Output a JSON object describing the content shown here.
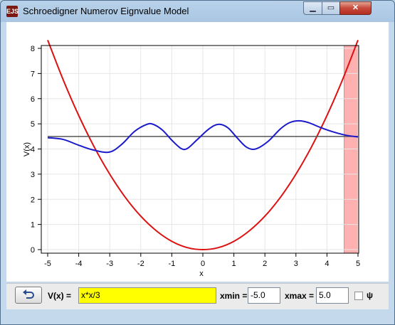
{
  "window": {
    "title": "Schroedigner Numerov Eignvalue Model",
    "icon_text": "EJS",
    "controls": {
      "minimize": "minimize-icon",
      "maximize": "maximize-icon",
      "close": "close-icon"
    }
  },
  "colors": {
    "potential": "#dd1111",
    "wavefunction": "#1a1acc",
    "energy_line": "#555555",
    "boundary_band": "#ffb0b0",
    "input_highlight": "#ffff00"
  },
  "chart_data": {
    "type": "line",
    "title": "",
    "xlabel": "x",
    "ylabel": "V(x)",
    "xlim": [
      -5,
      5
    ],
    "ylim": [
      -0.1,
      8.4
    ],
    "x_ticks": [
      "-5",
      "-4",
      "-3",
      "-2",
      "-1",
      "0",
      "1",
      "2",
      "3",
      "4",
      "5"
    ],
    "y_ticks": [
      "0",
      "1",
      "2",
      "3",
      "4",
      "5",
      "6",
      "7",
      "8"
    ],
    "grid": true,
    "series": [
      {
        "role": "potential",
        "color": "#dd1111",
        "formula": "x*x/3",
        "points": [
          [
            -5,
            8.33
          ],
          [
            -4.5,
            6.75
          ],
          [
            -4,
            5.33
          ],
          [
            -3.5,
            4.08
          ],
          [
            -3,
            3.0
          ],
          [
            -2.5,
            2.08
          ],
          [
            -2,
            1.33
          ],
          [
            -1.5,
            0.75
          ],
          [
            -1,
            0.33
          ],
          [
            -0.5,
            0.08
          ],
          [
            0,
            0
          ],
          [
            0.5,
            0.08
          ],
          [
            1,
            0.33
          ],
          [
            1.5,
            0.75
          ],
          [
            2,
            1.33
          ],
          [
            2.5,
            2.08
          ],
          [
            3,
            3.0
          ],
          [
            3.5,
            4.08
          ],
          [
            4,
            5.33
          ],
          [
            4.5,
            6.75
          ],
          [
            5,
            8.33
          ]
        ]
      },
      {
        "role": "energy",
        "color": "#555555",
        "points": [
          [
            -5,
            4.5
          ],
          [
            5,
            4.5
          ]
        ]
      },
      {
        "role": "wavefunction",
        "color": "#1a1acc",
        "points": [
          [
            -5,
            4.45
          ],
          [
            -4.5,
            4.38
          ],
          [
            -4,
            4.15
          ],
          [
            -3.5,
            3.95
          ],
          [
            -3,
            3.88
          ],
          [
            -2.6,
            4.2
          ],
          [
            -2.2,
            4.7
          ],
          [
            -1.8,
            4.98
          ],
          [
            -1.6,
            4.98
          ],
          [
            -1.3,
            4.75
          ],
          [
            -1,
            4.35
          ],
          [
            -0.7,
            4.02
          ],
          [
            -0.5,
            4.02
          ],
          [
            -0.2,
            4.35
          ],
          [
            0.2,
            4.8
          ],
          [
            0.5,
            4.98
          ],
          [
            0.8,
            4.85
          ],
          [
            1.1,
            4.45
          ],
          [
            1.4,
            4.08
          ],
          [
            1.7,
            4.0
          ],
          [
            2.1,
            4.3
          ],
          [
            2.5,
            4.8
          ],
          [
            2.8,
            5.05
          ],
          [
            3.1,
            5.12
          ],
          [
            3.4,
            5.05
          ],
          [
            3.8,
            4.85
          ],
          [
            4.2,
            4.68
          ],
          [
            4.6,
            4.55
          ],
          [
            5,
            4.48
          ]
        ]
      }
    ],
    "shaded_region": {
      "x_from": 4.55,
      "x_to": 5
    }
  },
  "controls_bar": {
    "back_icon": "reset-arrow-icon",
    "vx_label": "V(x) =",
    "vx_value": "x*x/3",
    "xmin_label": "xmin =",
    "xmin_value": "-5.0",
    "xmax_label": "xmax =",
    "xmax_value": "5.0",
    "psi_label": "ψ",
    "psi_checked": false
  }
}
